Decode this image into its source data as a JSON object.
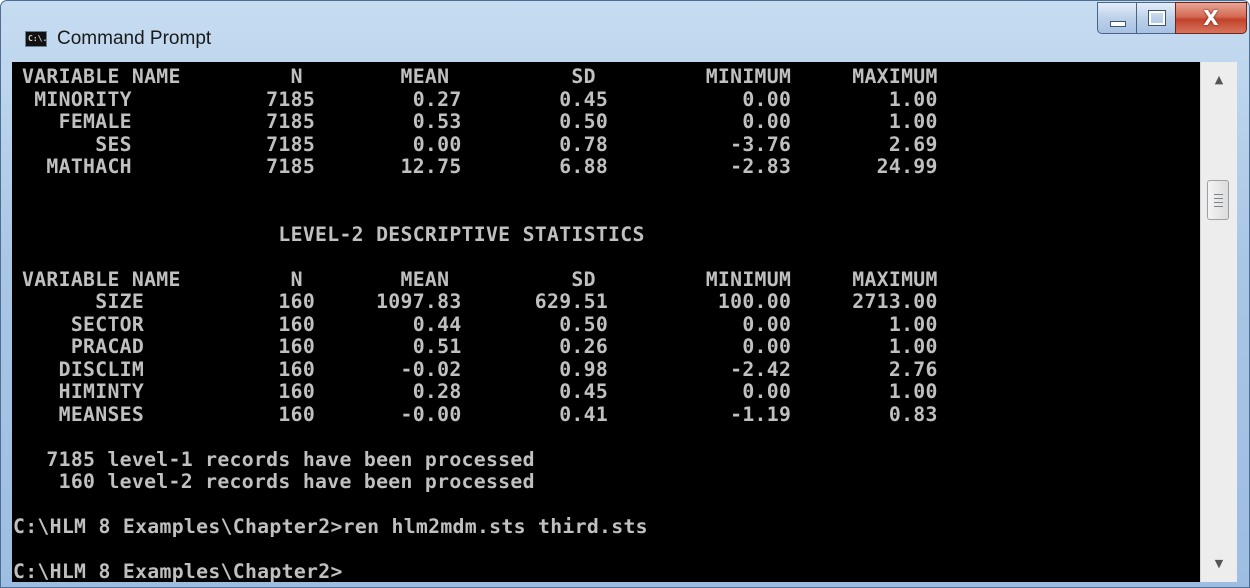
{
  "window": {
    "title": "Command Prompt",
    "app_icon_text": "C:\\."
  },
  "console": {
    "lines": [
      "VARIABLE NAME         N        MEAN          SD         MINIMUM     MAXIMUM",
      " MINORITY           7185        0.27        0.45           0.00        1.00",
      "   FEMALE           7185        0.53        0.50           0.00        1.00",
      "      SES           7185        0.00        0.78          -3.76        2.69",
      "  MATHACH           7185       12.75        6.88          -2.83       24.99",
      "",
      "",
      "                     LEVEL-2 DESCRIPTIVE STATISTICS",
      "",
      "VARIABLE NAME         N        MEAN          SD         MINIMUM     MAXIMUM",
      "      SIZE           160     1097.83      629.51         100.00     2713.00",
      "    SECTOR           160        0.44        0.50           0.00        1.00",
      "    PRACAD           160        0.51        0.26           0.00        1.00",
      "   DISCLIM           160       -0.02        0.98          -2.42        2.76",
      "   HIMINTY           160        0.28        0.45           0.00        1.00",
      "   MEANSES           160       -0.00        0.41          -1.19        0.83",
      "",
      "  7185 level-1 records have been processed",
      "   160 level-2 records have been processed",
      ""
    ],
    "prompt_lines": [
      "C:\\HLM 8 Examples\\Chapter2>ren hlm2mdm.sts third.sts",
      "",
      "C:\\HLM 8 Examples\\Chapter2>"
    ],
    "text_color": "#c0c0c0",
    "background_color": "#000000"
  },
  "scrollbar": {
    "up_icon": "scroll-up-arrow",
    "down_icon": "scroll-down-arrow"
  },
  "controls": {
    "close_glyph": "X"
  }
}
